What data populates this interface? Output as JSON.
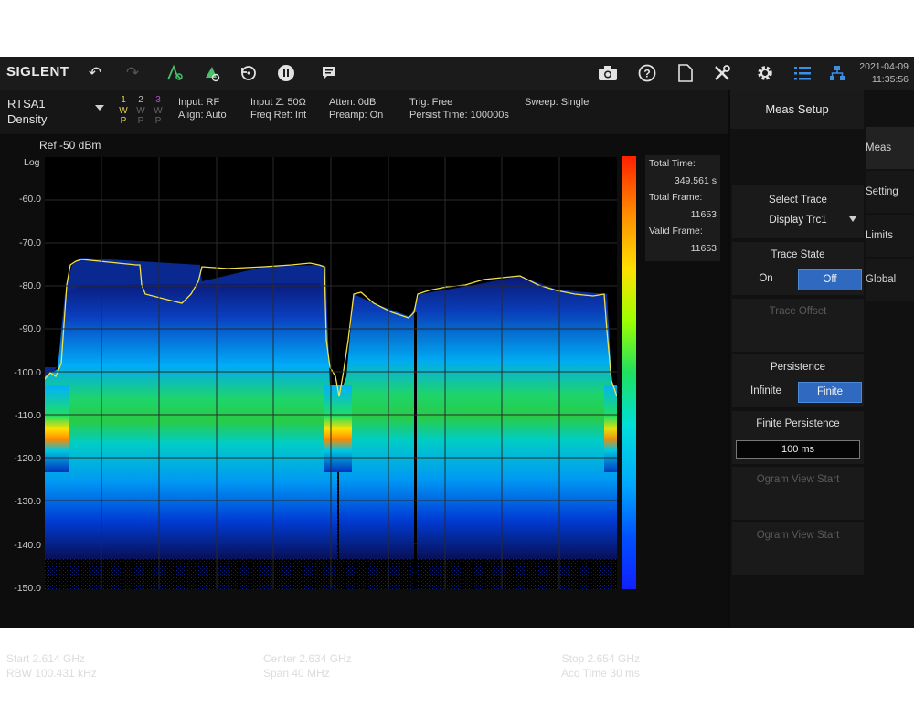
{
  "toolbar": {
    "brand": "SIGLENT",
    "icons": [
      "undo-icon",
      "redo-icon",
      "marker-icon",
      "peak-search-icon",
      "reset-icon",
      "pause-icon",
      "message-icon",
      "camera-icon",
      "help-icon",
      "file-icon",
      "tools-icon",
      "settings-icon",
      "menu-list-icon",
      "network-icon"
    ],
    "date": "2021-04-09",
    "time": "11:35:56"
  },
  "status": {
    "mode_line1": "RTSA1",
    "mode_line2": "Density",
    "traces": [
      {
        "num": "1",
        "type": "W",
        "det": "P",
        "color": "#e8d44a"
      },
      {
        "num": "2",
        "type": "W",
        "det": "P",
        "color": "#bfbfbf"
      },
      {
        "num": "3",
        "type": "W",
        "det": "P",
        "color": "#b24fd6"
      }
    ],
    "input": "Input: RF",
    "align": "Align: Auto",
    "input_z": "Input Z: 50Ω",
    "freq_ref": "Freq Ref: Int",
    "atten": "Atten: 0dB",
    "preamp": "Preamp: On",
    "trig": "Trig: Free",
    "persist_time": "Persist Time: 100000s",
    "sweep": "Sweep: Single"
  },
  "plot": {
    "ref": "Ref  -50 dBm",
    "scale": "Log",
    "y_ticks": [
      "-60.0",
      "-70.0",
      "-80.0",
      "-90.0",
      "-100.0",
      "-110.0",
      "-120.0",
      "-130.0",
      "-140.0",
      "-150.0"
    ],
    "info": {
      "total_time_label": "Total Time:",
      "total_time_value": "349.561 s",
      "total_frame_label": "Total Frame:",
      "total_frame_value": "11653",
      "valid_frame_label": "Valid Frame:",
      "valid_frame_value": "11653"
    }
  },
  "footer": {
    "start": "Start  2.614 GHz",
    "rbw": "RBW  100.431 kHz",
    "center": "Center  2.634 GHz",
    "span": "Span  40 MHz",
    "stop": "Stop  2.654 GHz",
    "acq": "Acq Time  30 ms"
  },
  "panel": {
    "title": "Meas Setup",
    "select_trace": "Select Trace",
    "display_trace": "Display Trc1",
    "trace_state": "Trace State",
    "on": "On",
    "off": "Off",
    "trace_offset": "Trace Offset",
    "persistence": "Persistence",
    "infinite": "Infinite",
    "finite": "Finite",
    "finite_persistence": "Finite Persistence",
    "finite_value": "100 ms",
    "ogram_start_1": "Ogram View Start",
    "ogram_start_2": "Ogram View Start",
    "tabs": [
      "Meas",
      "Setting",
      "Limits",
      "Global"
    ]
  }
}
